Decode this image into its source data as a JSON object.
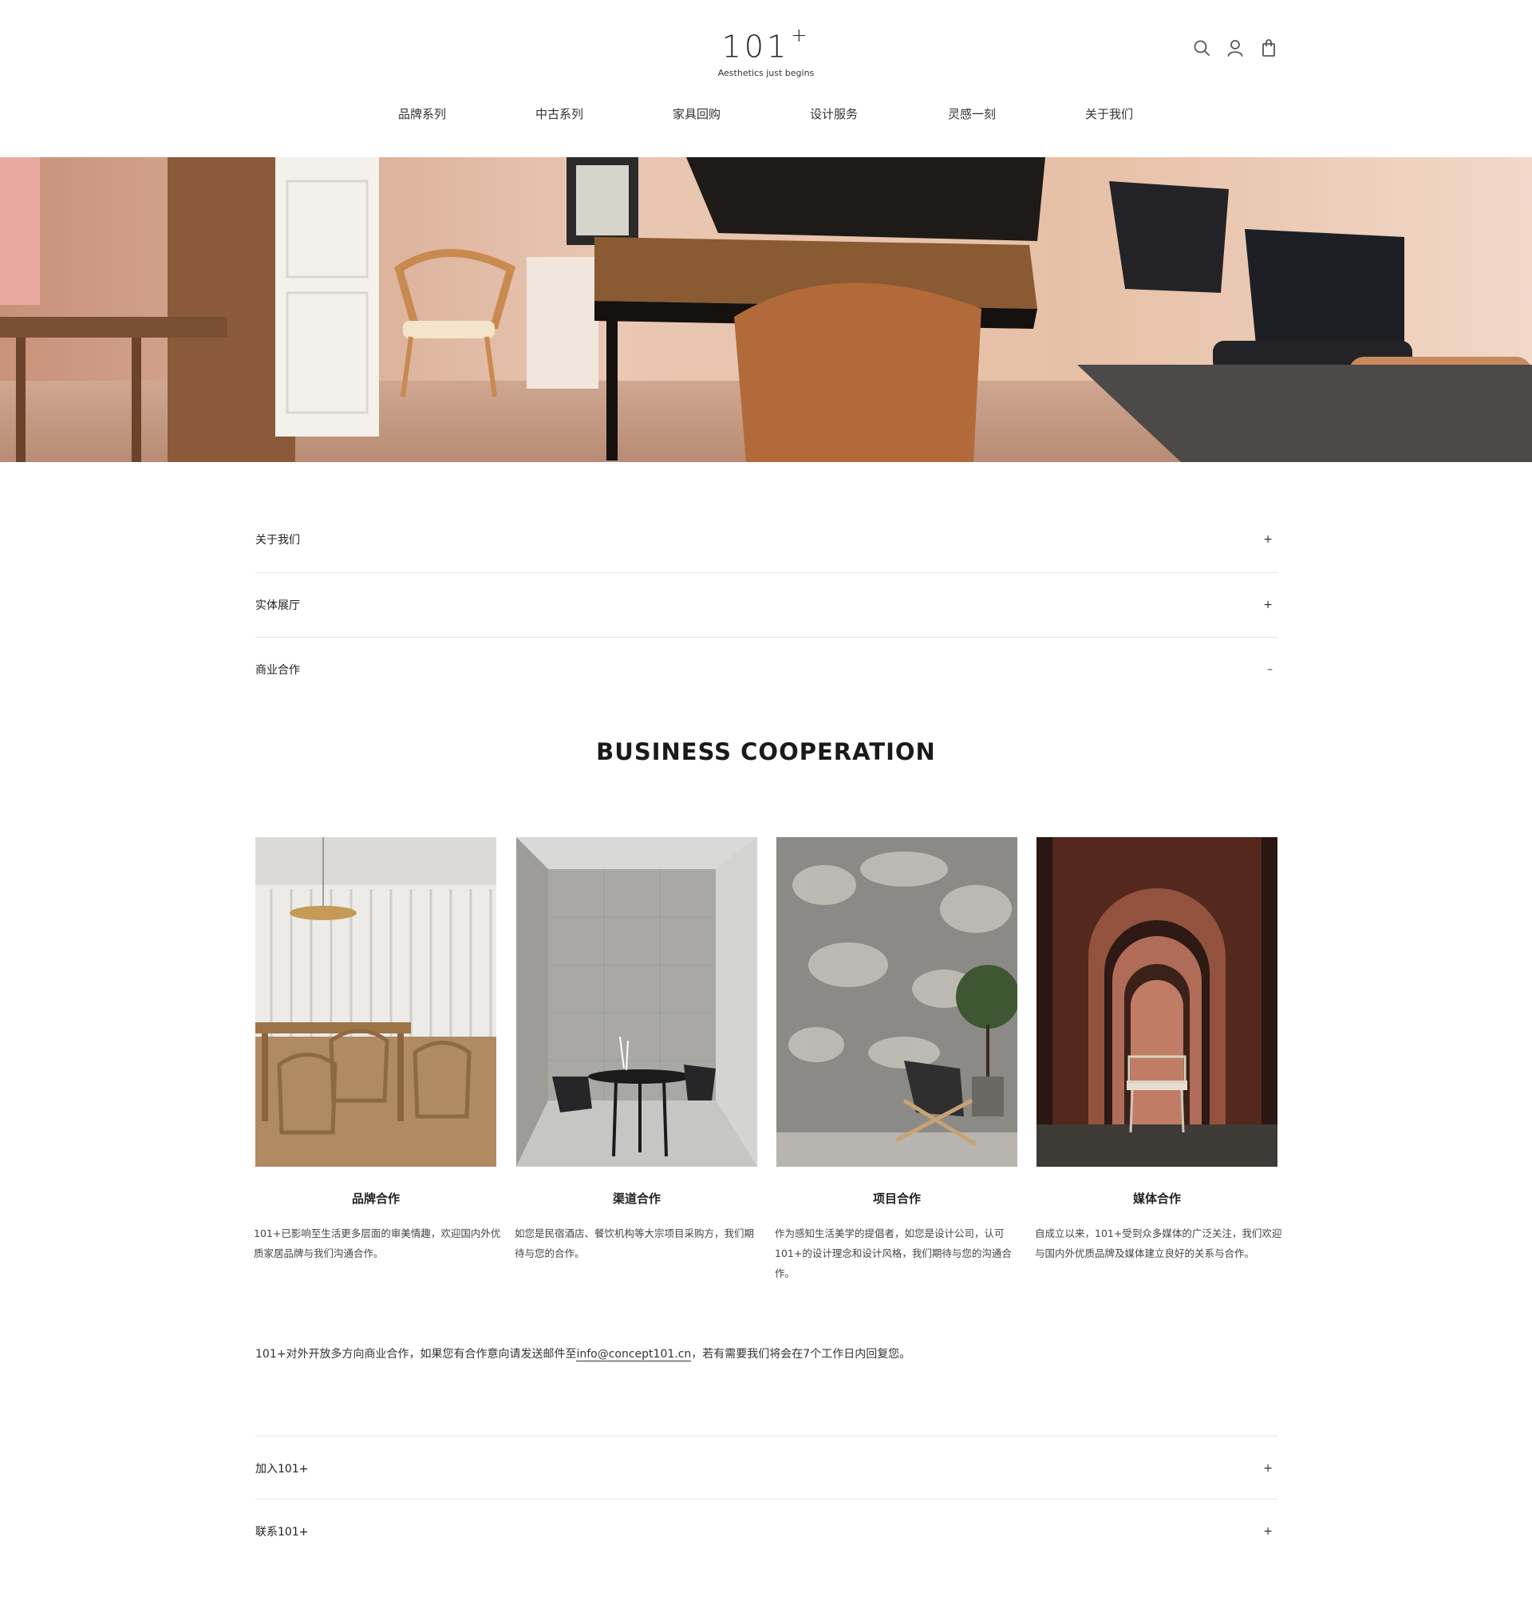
{
  "brand": {
    "logo_text": "101",
    "logo_sup": "+",
    "tagline": "Aesthetics just begins"
  },
  "header_icons": [
    "search-icon",
    "user-icon",
    "shopping-bag-icon"
  ],
  "nav": {
    "items": [
      {
        "label": "品牌系列"
      },
      {
        "label": "中古系列"
      },
      {
        "label": "家具回购"
      },
      {
        "label": "设计服务"
      },
      {
        "label": "灵感一刻"
      },
      {
        "label": "关于我们"
      }
    ]
  },
  "accordion": {
    "about": {
      "label": "关于我们",
      "toggle": "+"
    },
    "showroom": {
      "label": "实体展厅",
      "toggle": "+"
    },
    "business": {
      "label": "商业合作",
      "toggle": "–"
    },
    "join": {
      "label": "加入101+",
      "toggle": "+"
    },
    "contact": {
      "label": "联系101+",
      "toggle": "+"
    }
  },
  "business": {
    "title": "BUSINESS COOPERATION",
    "cards": [
      {
        "title": "品牌合作",
        "desc": "101+已影响至生活更多层面的审美情趣，欢迎国内外优质家居品牌与我们沟通合作。"
      },
      {
        "title": "渠道合作",
        "desc": "如您是民宿酒店、餐饮机构等大宗项目采购方，我们期待与您的合作。"
      },
      {
        "title": "项目合作",
        "desc": "作为感知生活美学的提倡者，如您是设计公司，认可101+的设计理念和设计风格，我们期待与您的沟通合作。"
      },
      {
        "title": "媒体合作",
        "desc": "自成立以来，101+受到众多媒体的广泛关注，我们欢迎与国内外优质品牌及媒体建立良好的关系与合作。"
      }
    ],
    "contact_prefix": "101+对外开放多方向商业合作，如果您有合作意向请发送邮件至",
    "contact_email": "info@concept101.cn",
    "contact_suffix": "，若有需要我们将会在7个工作日内回复您。"
  },
  "colors": {
    "text": "#222222",
    "divider": "#e6e6e6",
    "background": "#ffffff"
  }
}
